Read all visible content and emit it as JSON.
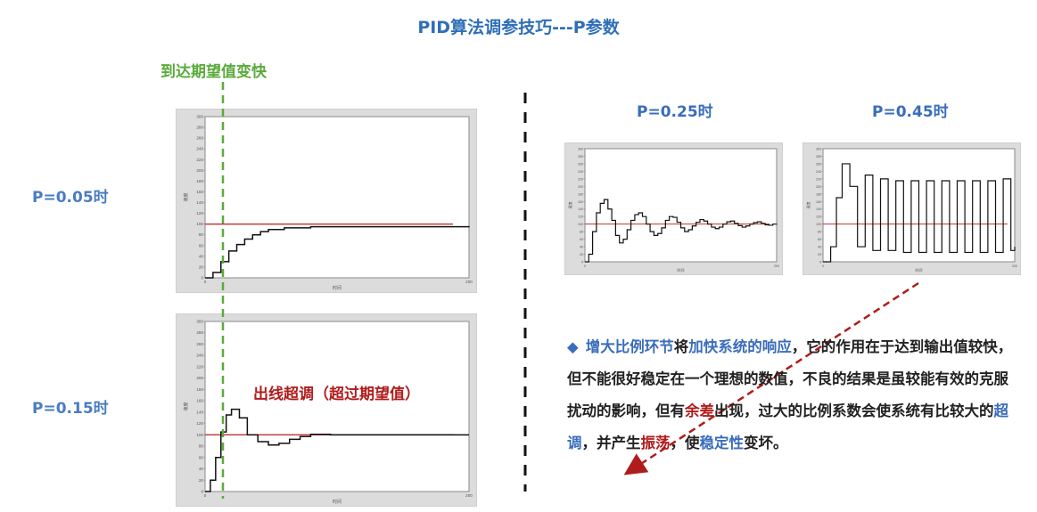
{
  "title": "PID算法调参技巧---P参数",
  "left_annotation": "到达期望值变快",
  "overshoot_annotation": "出线超调（超过期望值）",
  "labels": {
    "p005": "P=0.05时",
    "p015": "P=0.15时",
    "p025": "P=0.25时",
    "p045": "P=0.45时"
  },
  "plot_axes": {
    "ylabel": "速度",
    "xlabel": "时间",
    "x_end": "200",
    "yticks": [
      "300",
      "280",
      "260",
      "240",
      "220",
      "200",
      "180",
      "160",
      "140",
      "120",
      "100",
      "80",
      "60",
      "40",
      "20",
      "0"
    ]
  },
  "colors": {
    "title": "#2f6fb7",
    "accent_blue": "#3a6dbb",
    "accent_red": "#b01c1c",
    "green": "#5aab3b",
    "setpoint": "#c0302f"
  },
  "description": {
    "p1_blue": "增大比例环节",
    "p2": "将",
    "p3_blue": "加快系统的响应",
    "p4": "，它的作用在于达到输出值较快，但不能很好稳定在一个理想的数值，不良的结果是虽较能有效的克服扰动的影响，但有",
    "p5_red": "余差",
    "p6": "出现，过大的比例系数会使系统有比较大的",
    "p7_blue": "超调",
    "p8": "，并产生",
    "p9_red": "振荡",
    "p10": "，使",
    "p11_blue": "稳定性",
    "p12": "变坏。"
  },
  "chart_data": [
    {
      "type": "line",
      "title": "P=0.05时",
      "setpoint": 100,
      "xlabel": "时间",
      "ylabel": "速度",
      "ylim": [
        0,
        300
      ],
      "x": [
        0,
        6,
        12,
        18,
        24,
        30,
        36,
        42,
        48,
        60,
        80,
        100,
        140,
        200
      ],
      "values": [
        0,
        10,
        30,
        50,
        62,
        72,
        80,
        86,
        90,
        93,
        95,
        95,
        95,
        94
      ]
    },
    {
      "type": "line",
      "title": "P=0.15时",
      "setpoint": 100,
      "xlabel": "时间",
      "ylabel": "速度",
      "ylim": [
        0,
        300
      ],
      "x": [
        0,
        4,
        8,
        12,
        16,
        20,
        26,
        32,
        40,
        48,
        56,
        64,
        72,
        80,
        95,
        200
      ],
      "values": [
        0,
        20,
        60,
        105,
        135,
        145,
        130,
        100,
        88,
        82,
        85,
        92,
        97,
        101,
        100,
        100
      ]
    },
    {
      "type": "line",
      "title": "P=0.25时",
      "setpoint": 100,
      "xlabel": "时间",
      "ylabel": "速度",
      "ylim": [
        0,
        300
      ],
      "x": [
        0,
        4,
        8,
        12,
        16,
        20,
        24,
        28,
        32,
        36,
        40,
        44,
        48,
        52,
        56,
        60,
        64,
        68,
        72,
        76,
        80,
        84,
        88,
        92,
        96,
        100,
        104,
        108,
        112,
        116,
        120,
        124,
        128,
        132,
        136,
        140,
        144,
        148,
        152,
        156,
        160,
        164,
        168,
        172,
        176,
        180,
        184,
        188,
        192,
        196,
        200
      ],
      "values": [
        0,
        20,
        80,
        130,
        155,
        165,
        140,
        110,
        70,
        50,
        60,
        85,
        110,
        125,
        130,
        120,
        100,
        80,
        70,
        75,
        90,
        110,
        120,
        118,
        105,
        90,
        80,
        85,
        95,
        105,
        112,
        108,
        100,
        92,
        88,
        92,
        100,
        106,
        108,
        102,
        96,
        92,
        95,
        100,
        104,
        106,
        102,
        98,
        97,
        100,
        101
      ]
    },
    {
      "type": "line",
      "title": "P=0.45时",
      "setpoint": 100,
      "xlabel": "时间",
      "ylabel": "速度",
      "ylim": [
        0,
        300
      ],
      "x": [
        0,
        8,
        14,
        20,
        28,
        36,
        44,
        52,
        60,
        68,
        76,
        84,
        92,
        100,
        108,
        116,
        124,
        132,
        140,
        148,
        156,
        164,
        172,
        180,
        188,
        196,
        200
      ],
      "values": [
        0,
        40,
        170,
        260,
        200,
        40,
        230,
        30,
        220,
        30,
        215,
        25,
        215,
        25,
        215,
        25,
        215,
        25,
        215,
        25,
        215,
        25,
        215,
        25,
        220,
        30,
        40
      ]
    }
  ]
}
